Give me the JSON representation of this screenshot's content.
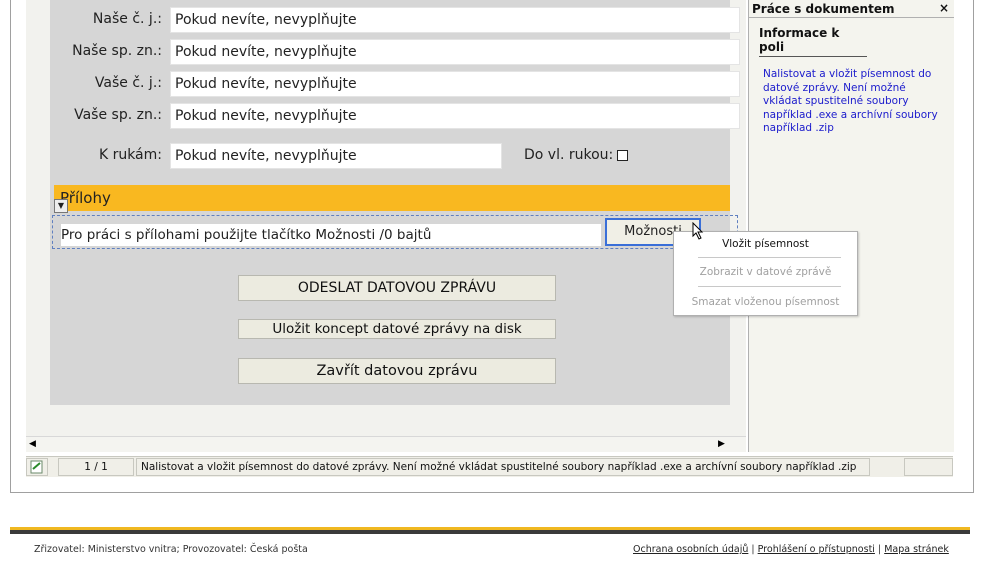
{
  "form": {
    "fields": [
      {
        "label": "Naše č. j.:",
        "value": "Pokud nevíte, nevyplňujte"
      },
      {
        "label": "Naše sp. zn.:",
        "value": "Pokud nevíte, nevyplňujte"
      },
      {
        "label": "Vaše č. j.:",
        "value": "Pokud nevíte, nevyplňujte"
      },
      {
        "label": "Vaše sp. zn.:",
        "value": "Pokud nevíte, nevyplňujte"
      }
    ],
    "k_rukam": {
      "label": "K rukám:",
      "value": "Pokud nevíte, nevyplňujte"
    },
    "do_vl_rukou": {
      "label": "Do vl. rukou:"
    },
    "attachments": {
      "title": "Přílohy",
      "info": "Pro práci s přílohami použijte tlačítko Možnosti /0 bajtů",
      "options_button": "Možnosti"
    },
    "buttons": {
      "send": "ODESLAT DATOVOU ZPRÁVU",
      "save_draft": "Uložit koncept datové zprávy na disk",
      "close": "Zavřít datovou zprávu"
    }
  },
  "context_menu": {
    "items": [
      {
        "label": "Vložit písemnost",
        "enabled": true
      },
      {
        "label": "Zobrazit v datové zprávě",
        "enabled": false
      },
      {
        "label": "Smazat vloženou písemnost",
        "enabled": false
      }
    ]
  },
  "panel": {
    "title": "Práce s dokumentem",
    "close": "×",
    "tab": "Informace k poli",
    "info": "Nalistovat a vložit písemnost do datové zprávy. Není možné vkládat spustitelné soubory například .exe a archívní soubory například .zip"
  },
  "status": {
    "page": "1 / 1",
    "message": "Nalistovat a vložit písemnost do datové zprávy. Není možné vkládat spustitelné soubory například .exe a archívní soubory například .zip"
  },
  "footer": {
    "left": "Zřizovatel: Ministerstvo vnitra; Provozovatel: Česká pošta",
    "links": [
      "Ochrana osobních údajů",
      "Prohlášení o přístupnosti",
      "Mapa stránek"
    ],
    "separator": " | "
  },
  "colors": {
    "section_bar": "#f9b820",
    "panel_text": "#1b1bcc",
    "focus": "#3a6fd8"
  }
}
